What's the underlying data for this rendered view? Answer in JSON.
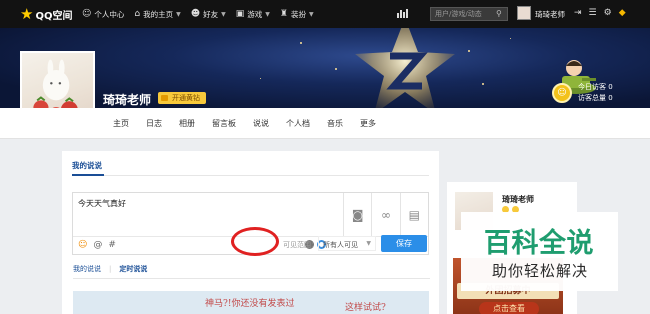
{
  "topbar": {
    "logo_text": "QQ空间",
    "nav": [
      {
        "icon": "person-icon",
        "label": "个人中心",
        "arrow": false
      },
      {
        "icon": "home-icon",
        "label": "我的主页",
        "arrow": true
      },
      {
        "icon": "friends-icon",
        "label": "好友",
        "arrow": true
      },
      {
        "icon": "game-icon",
        "label": "游戏",
        "arrow": true
      },
      {
        "icon": "shirt-icon",
        "label": "装扮",
        "arrow": true
      }
    ],
    "search_placeholder": "用户/游戏/动态",
    "username": "琦琦老师"
  },
  "profile": {
    "nickname": "琦琦老师",
    "vip_label": "开通黄钻",
    "visits_today_label": "今日访客",
    "visits_today": "0",
    "visits_total_label": "访客总量",
    "visits_total": "0"
  },
  "tabs": [
    "主页",
    "日志",
    "相册",
    "留言板",
    "说说",
    "个人档",
    "音乐",
    "更多"
  ],
  "main": {
    "title": "我的说说",
    "editor_text": "今天天气真好",
    "scope_label": "可见范围：",
    "scope_value": "所有人可见",
    "save_label": "保存",
    "sublink_mine": "我的说说",
    "sublink_sep": "|",
    "sublink_scheduled": "定时说说",
    "doodle_text_1": "神马?!你还没有发表过",
    "doodle_text_2": "这样试试?"
  },
  "right": {
    "name": "琦琦老师",
    "ad_line1": "外团招募中",
    "ad_line2": "点击查看"
  },
  "watermark": {
    "title": "百科全说",
    "subtitle": "助你轻松解决"
  },
  "colors": {
    "topbar": "#121212",
    "accent": "#2b8ee8",
    "link": "#1a4e96",
    "vip": "#f7c93b",
    "highlight_circle": "#e02121",
    "watermark_green": "#1f9d6f"
  }
}
